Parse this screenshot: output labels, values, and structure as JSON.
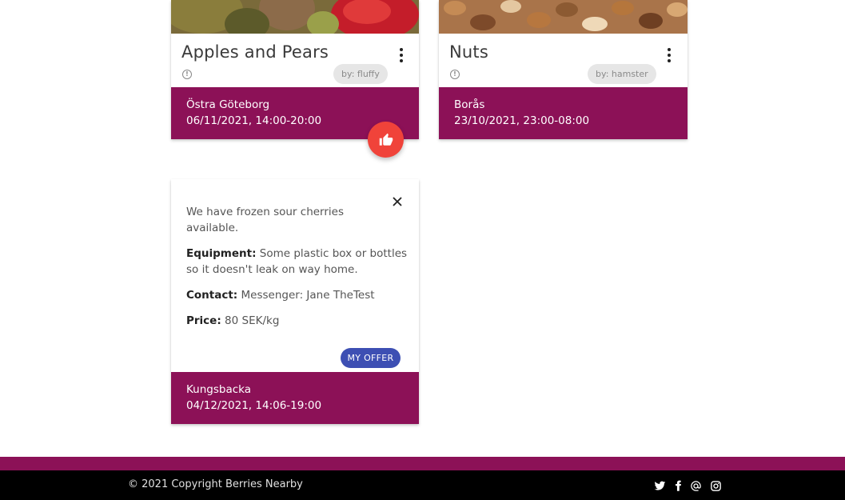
{
  "cards": [
    {
      "title": "Apples and Pears",
      "author": "by: fluffy",
      "location": "Östra Göteborg",
      "datetime": "06/11/2021, 14:00-20:00"
    },
    {
      "title": "Nuts",
      "author": "by: hamster",
      "location": "Borås",
      "datetime": "23/10/2021, 23:00-08:00"
    }
  ],
  "detail": {
    "description": "We have frozen sour cherries available.",
    "equipment_label": "Equipment:",
    "equipment_value": "Some plastic box or bottles so it doesn't leak on way home.",
    "contact_label": "Contact:",
    "contact_value": "Messenger: Jane TheTest",
    "price_label": "Price:",
    "price_value": "80 SEK/kg",
    "my_offer_label": "MY OFFER",
    "location": "Kungsbacka",
    "datetime": "04/12/2021, 14:06-19:00"
  },
  "footer": {
    "copyright": "© 2021 Copyright Berries Nearby",
    "social_icons": [
      "twitter-icon",
      "facebook-icon",
      "email-at-icon",
      "instagram-icon"
    ]
  },
  "colors": {
    "accent_footer": "#8c1157",
    "like_button": "#f0433a",
    "my_offer_button": "#3d4fb3",
    "site_footer": "#000000"
  }
}
